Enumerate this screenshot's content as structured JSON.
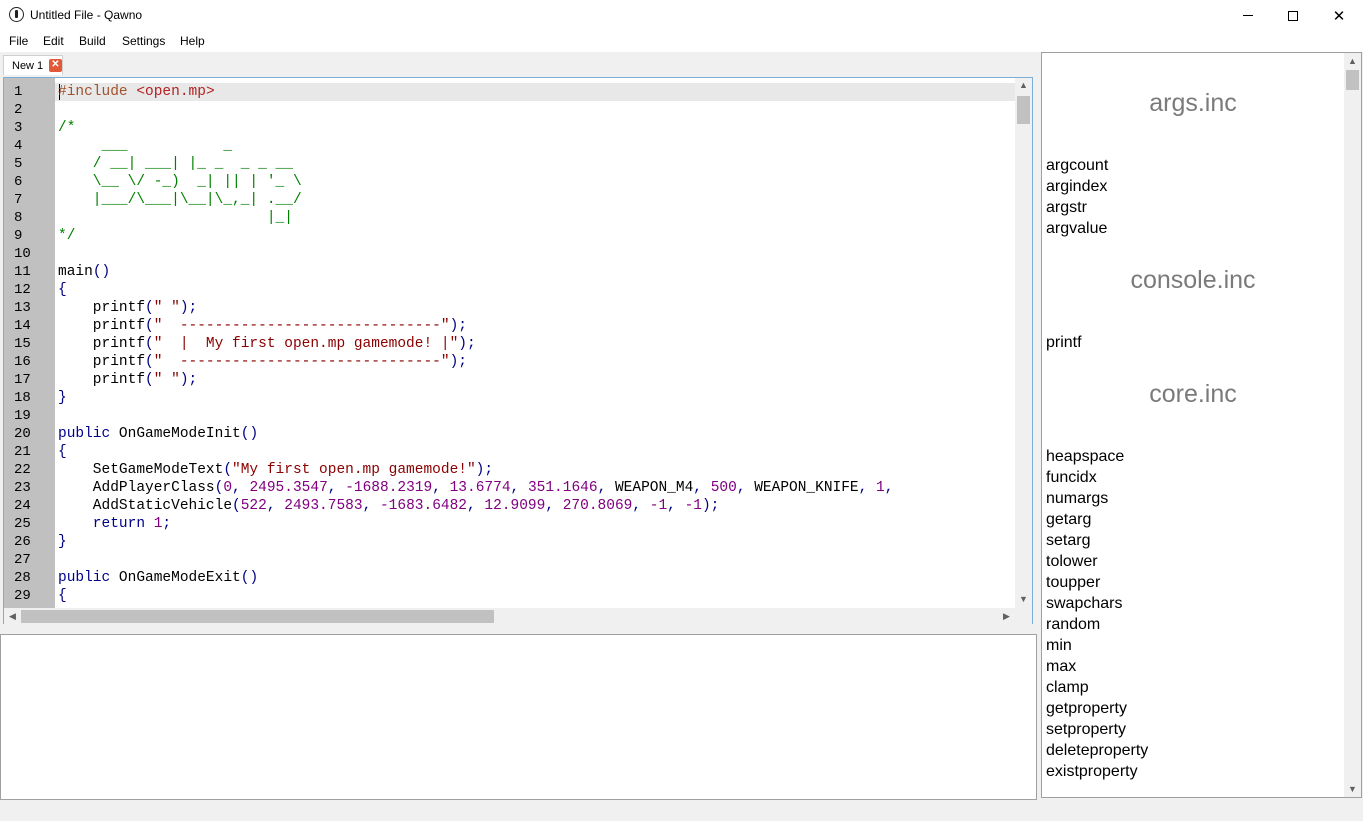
{
  "window": {
    "title": "Untitled File - Qawno",
    "minimize_glyph": "—",
    "maximize_glyph": "☐",
    "close_glyph": "✕"
  },
  "menu": [
    "File",
    "Edit",
    "Build",
    "Settings",
    "Help"
  ],
  "tabs": [
    {
      "label": "New 1",
      "close_glyph": "✕"
    }
  ],
  "editor": {
    "line_numbers": [
      "1",
      "2",
      "3",
      "4",
      "5",
      "6",
      "7",
      "8",
      "9",
      "10",
      "11",
      "12",
      "13",
      "14",
      "15",
      "16",
      "17",
      "18",
      "19",
      "20",
      "21",
      "22",
      "23",
      "24",
      "25",
      "26",
      "27",
      "28",
      "29"
    ],
    "lines": [
      [
        [
          "pre",
          "#include "
        ],
        [
          "inc",
          "<open.mp>"
        ]
      ],
      [],
      [
        [
          "com",
          "/*"
        ]
      ],
      [
        [
          "com",
          "     ___           _"
        ]
      ],
      [
        [
          "com",
          "    / __| ___| |_ _  _ _ __"
        ]
      ],
      [
        [
          "com",
          "    \\__ \\/ -_)  _| || | '_ \\"
        ]
      ],
      [
        [
          "com",
          "    |___/\\___|\\__|\\_,_| .__/"
        ]
      ],
      [
        [
          "com",
          "                        |_|"
        ]
      ],
      [
        [
          "com",
          "*/"
        ]
      ],
      [],
      [
        [
          "fn",
          "main"
        ],
        [
          "pun",
          "()"
        ]
      ],
      [
        [
          "pun",
          "{"
        ]
      ],
      [
        [
          "fn",
          "    printf"
        ],
        [
          "pun",
          "("
        ],
        [
          "str",
          "\" \""
        ],
        [
          "pun",
          ");"
        ]
      ],
      [
        [
          "fn",
          "    printf"
        ],
        [
          "pun",
          "("
        ],
        [
          "str",
          "\"  ------------------------------\""
        ],
        [
          "pun",
          ");"
        ]
      ],
      [
        [
          "fn",
          "    printf"
        ],
        [
          "pun",
          "("
        ],
        [
          "str",
          "\"  |  My first open.mp gamemode! |\""
        ],
        [
          "pun",
          ");"
        ]
      ],
      [
        [
          "fn",
          "    printf"
        ],
        [
          "pun",
          "("
        ],
        [
          "str",
          "\"  ------------------------------\""
        ],
        [
          "pun",
          ");"
        ]
      ],
      [
        [
          "fn",
          "    printf"
        ],
        [
          "pun",
          "("
        ],
        [
          "str",
          "\" \""
        ],
        [
          "pun",
          ");"
        ]
      ],
      [
        [
          "pun",
          "}"
        ]
      ],
      [],
      [
        [
          "kw",
          "public "
        ],
        [
          "fn",
          "OnGameModeInit"
        ],
        [
          "pun",
          "()"
        ]
      ],
      [
        [
          "pun",
          "{"
        ]
      ],
      [
        [
          "fn",
          "    SetGameModeText"
        ],
        [
          "pun",
          "("
        ],
        [
          "str",
          "\"My first open.mp gamemode!\""
        ],
        [
          "pun",
          ");"
        ]
      ],
      [
        [
          "fn",
          "    AddPlayerClass"
        ],
        [
          "pun",
          "("
        ],
        [
          "num",
          "0"
        ],
        [
          "pun",
          ", "
        ],
        [
          "num",
          "2495.3547"
        ],
        [
          "pun",
          ", "
        ],
        [
          "num",
          "-1688.2319"
        ],
        [
          "pun",
          ", "
        ],
        [
          "num",
          "13.6774"
        ],
        [
          "pun",
          ", "
        ],
        [
          "num",
          "351.1646"
        ],
        [
          "pun",
          ", "
        ],
        [
          "fn",
          "WEAPON_M4"
        ],
        [
          "pun",
          ", "
        ],
        [
          "num",
          "500"
        ],
        [
          "pun",
          ", "
        ],
        [
          "fn",
          "WEAPON_KNIFE"
        ],
        [
          "pun",
          ", "
        ],
        [
          "num",
          "1"
        ],
        [
          "pun",
          ","
        ]
      ],
      [
        [
          "fn",
          "    AddStaticVehicle"
        ],
        [
          "pun",
          "("
        ],
        [
          "num",
          "522"
        ],
        [
          "pun",
          ", "
        ],
        [
          "num",
          "2493.7583"
        ],
        [
          "pun",
          ", "
        ],
        [
          "num",
          "-1683.6482"
        ],
        [
          "pun",
          ", "
        ],
        [
          "num",
          "12.9099"
        ],
        [
          "pun",
          ", "
        ],
        [
          "num",
          "270.8069"
        ],
        [
          "pun",
          ", "
        ],
        [
          "num",
          "-1"
        ],
        [
          "pun",
          ", "
        ],
        [
          "num",
          "-1"
        ],
        [
          "pun",
          ");"
        ]
      ],
      [
        [
          "kw",
          "    return "
        ],
        [
          "num",
          "1"
        ],
        [
          "pun",
          ";"
        ]
      ],
      [
        [
          "pun",
          "}"
        ]
      ],
      [],
      [
        [
          "kw",
          "public "
        ],
        [
          "fn",
          "OnGameModeExit"
        ],
        [
          "pun",
          "()"
        ]
      ],
      [
        [
          "pun",
          "{"
        ]
      ]
    ]
  },
  "scroll_arrows": {
    "up": "▲",
    "down": "▼",
    "left": "◀",
    "right": "▶"
  },
  "function_list": {
    "groups": [
      {
        "header": "args.inc",
        "items": [
          "argcount",
          "argindex",
          "argstr",
          "argvalue"
        ]
      },
      {
        "header": "console.inc",
        "items": [
          "printf"
        ]
      },
      {
        "header": "core.inc",
        "items": [
          "heapspace",
          "funcidx",
          "numargs",
          "getarg",
          "setarg",
          "tolower",
          "toupper",
          "swapchars",
          "random",
          "min",
          "max",
          "clamp",
          "getproperty",
          "setproperty",
          "deleteproperty",
          "existproperty"
        ]
      }
    ]
  }
}
